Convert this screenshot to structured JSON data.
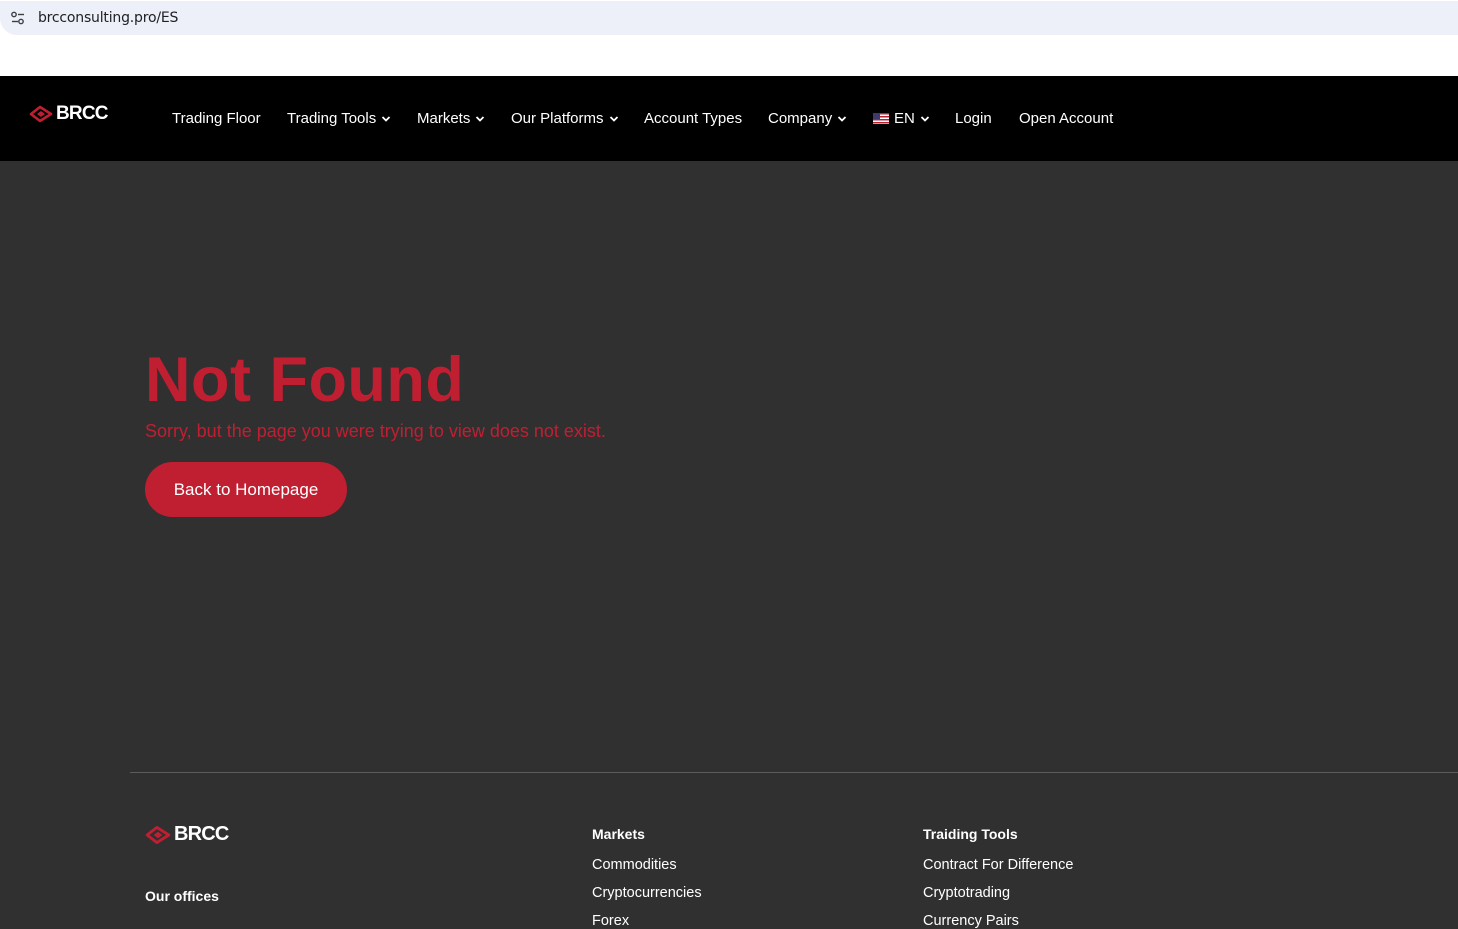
{
  "browser": {
    "url": "brcconsulting.pro/ES",
    "site_info_icon": "tune-icon"
  },
  "header": {
    "logo_text": "BRCC",
    "nav": [
      {
        "label": "Trading Floor",
        "dropdown": false
      },
      {
        "label": "Trading Tools",
        "dropdown": true
      },
      {
        "label": "Markets",
        "dropdown": true
      },
      {
        "label": "Our Platforms",
        "dropdown": true
      },
      {
        "label": "Account Types",
        "dropdown": false
      },
      {
        "label": "Company",
        "dropdown": true
      },
      {
        "label": "EN",
        "dropdown": true,
        "flag": "us-flag-icon"
      },
      {
        "label": "Login",
        "dropdown": false
      },
      {
        "label": "Open Account",
        "dropdown": false
      }
    ]
  },
  "main": {
    "title": "Not Found",
    "subtitle": "Sorry, but the page you were trying to view does not exist.",
    "button_label": "Back to Homepage"
  },
  "footer": {
    "logo_text": "BRCC",
    "offices_heading": "Our offices",
    "markets": {
      "heading": "Markets",
      "links": [
        "Commodities",
        "Cryptocurrencies",
        "Forex"
      ]
    },
    "tools": {
      "heading": "Traiding Tools",
      "links": [
        "Contract For Difference",
        "Cryptotrading",
        "Currency Pairs"
      ]
    }
  },
  "colors": {
    "accent": "#c01f32",
    "page_bg": "#303030",
    "header_bg": "#000000"
  }
}
